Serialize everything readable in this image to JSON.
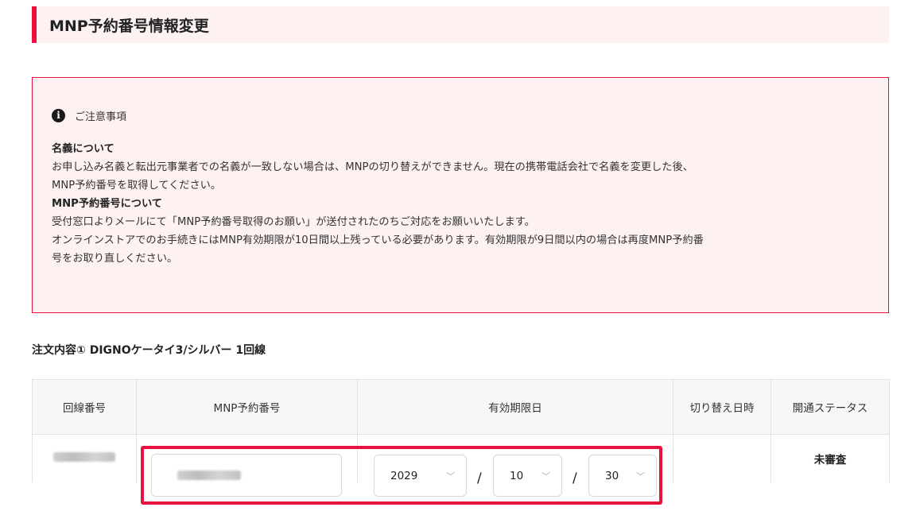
{
  "page": {
    "title": "MNP予約番号情報変更"
  },
  "notice": {
    "title": "ご注意事項",
    "icon": "info-icon",
    "section1_heading": "名義について",
    "section1_line1": "お申し込み名義と転出元事業者での名義が一致しない場合は、MNPの切り替えができません。現在の携帯電話会社で名義を変更した後、",
    "section1_line2": "MNP予約番号を取得してください。",
    "section2_heading": "MNP予約番号について",
    "section2_line1": "受付窓口よりメールにて「MNP予約番号取得のお願い」が送付されたのちご対応をお願いいたします。",
    "section2_line2": "オンラインストアでのお手続きにはMNP有効期限が10日間以上残っている必要があります。有効期限が9日間以内の場合は再度MNP予約番",
    "section2_line3": "号をお取り直しください。"
  },
  "order": {
    "title": "注文内容① DIGNOケータイ3/シルバー 1回線",
    "columns": [
      "回線番号",
      "MNP予約番号",
      "有効期限日",
      "切り替え日時",
      "開通ステータス"
    ],
    "row": {
      "expiry_year": "2029",
      "expiry_month": "10",
      "expiry_day": "30",
      "separator": "/",
      "switch_datetime": "",
      "status": "未審査"
    }
  },
  "colors": {
    "accent": "#e8123c",
    "notice_bg": "#fdf1f1",
    "header_bg": "#f7f7f7"
  }
}
